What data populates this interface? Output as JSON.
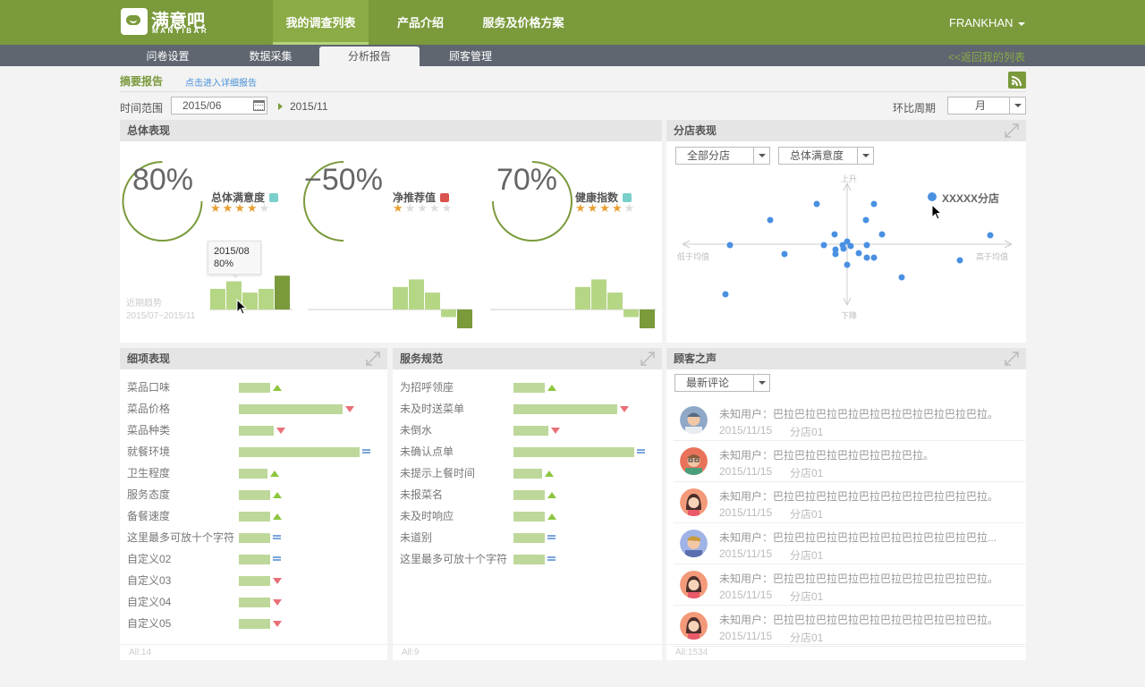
{
  "brand": {
    "name_cn": "满意吧",
    "name_en": "MANYIBAR"
  },
  "top_nav": [
    "我的调查列表",
    "产品介绍",
    "服务及价格方案"
  ],
  "user": {
    "name": "FRANKHAN"
  },
  "sub_nav": [
    "问卷设置",
    "数据采集",
    "分析报告",
    "顾客管理"
  ],
  "back_link": "<<返回我的列表",
  "page_title": "摘要报告",
  "detail_link": "点击进入详细报告",
  "filters": {
    "range_label": "时间范围",
    "start": "2015/06",
    "end": "2015/11",
    "cycle_label": "环比周期",
    "cycle_value": "月"
  },
  "overall": {
    "title": "总体表现",
    "metrics": [
      {
        "value": "80%",
        "name": "总体满意度",
        "color": "#79cfcb",
        "stars": 4,
        "trend": [
          0.55,
          0.75,
          0.45,
          0.55,
          0.9
        ]
      },
      {
        "value": "−50%",
        "name": "净推荐值",
        "color": "#d9534f",
        "stars": 1,
        "trend": [
          0.6,
          0.8,
          0.45,
          -0.2,
          -0.5
        ]
      },
      {
        "value": "70%",
        "name": "健康指数",
        "color": "#79cfcb",
        "stars": 4,
        "trend": [
          0.6,
          0.8,
          0.45,
          -0.2,
          -0.5
        ]
      }
    ],
    "trend_label": "近期趋势",
    "trend_range": "2015/07~2015/11",
    "tooltip": {
      "date": "2015/08",
      "value": "80%"
    }
  },
  "branch": {
    "title": "分店表现",
    "select_branch": "全部分店",
    "select_metric": "总体满意度",
    "axis_up": "上升",
    "axis_down": "下降",
    "axis_left": "低于均值",
    "axis_right": "高于均值",
    "highlight_label": "XXXXX分店",
    "color": "#4a90e2"
  },
  "details": {
    "title": "细项表现",
    "rows": [
      {
        "label": "菜品口味",
        "value": 0.26,
        "trend": "up"
      },
      {
        "label": "菜品价格",
        "value": 0.86,
        "trend": "down"
      },
      {
        "label": "菜品种类",
        "value": 0.29,
        "trend": "down"
      },
      {
        "label": "就餐环境",
        "value": 1.0,
        "trend": "eq"
      },
      {
        "label": "卫生程度",
        "value": 0.24,
        "trend": "up"
      },
      {
        "label": "服务态度",
        "value": 0.26,
        "trend": "up"
      },
      {
        "label": "备餐速度",
        "value": 0.26,
        "trend": "up"
      },
      {
        "label": "这里最多可放十个字符",
        "value": 0.26,
        "trend": "eq"
      },
      {
        "label": "自定义02",
        "value": 0.26,
        "trend": "eq"
      },
      {
        "label": "自定义03",
        "value": 0.26,
        "trend": "down"
      },
      {
        "label": "自定义04",
        "value": 0.26,
        "trend": "down"
      },
      {
        "label": "自定义05",
        "value": 0.26,
        "trend": "down"
      }
    ],
    "footer": "All:14"
  },
  "service": {
    "title": "服务规范",
    "rows": [
      {
        "label": "为招呼领座",
        "value": 0.26,
        "trend": "up"
      },
      {
        "label": "未及时送菜单",
        "value": 0.86,
        "trend": "down"
      },
      {
        "label": "未倒水",
        "value": 0.29,
        "trend": "down"
      },
      {
        "label": "未确认点单",
        "value": 1.0,
        "trend": "eq"
      },
      {
        "label": "未提示上餐时间",
        "value": 0.24,
        "trend": "up"
      },
      {
        "label": "未报菜名",
        "value": 0.26,
        "trend": "up"
      },
      {
        "label": "未及时响应",
        "value": 0.26,
        "trend": "up"
      },
      {
        "label": "未道别",
        "value": 0.26,
        "trend": "eq"
      },
      {
        "label": "这里最多可放十个字符",
        "value": 0.26,
        "trend": "eq"
      }
    ],
    "footer": "All:9"
  },
  "voices": {
    "title": "顾客之声",
    "select": "最新评论",
    "items": [
      {
        "text": "未知用户：巴拉巴拉巴拉巴拉巴拉巴拉巴拉巴拉巴拉巴拉。",
        "date": "2015/11/15",
        "shop": "分店01",
        "avatar": "man-cap"
      },
      {
        "text": "未知用户：巴拉巴拉巴拉巴拉巴拉巴拉巴拉。",
        "date": "2015/11/15",
        "shop": "分店01",
        "avatar": "man-glasses"
      },
      {
        "text": "未知用户：巴拉巴拉巴拉巴拉巴拉巴拉巴拉巴拉巴拉巴拉。",
        "date": "2015/11/15",
        "shop": "分店01",
        "avatar": "woman"
      },
      {
        "text": "未知用户：巴拉巴拉巴拉巴拉巴拉巴拉巴拉巴拉巴拉巴拉...",
        "date": "2015/11/15",
        "shop": "分店01",
        "avatar": "man-blue"
      },
      {
        "text": "未知用户：巴拉巴拉巴拉巴拉巴拉巴拉巴拉巴拉巴拉巴拉。",
        "date": "2015/11/15",
        "shop": "分店01",
        "avatar": "woman"
      },
      {
        "text": "未知用户：巴拉巴拉巴拉巴拉巴拉巴拉巴拉巴拉巴拉巴拉。",
        "date": "2015/11/15",
        "shop": "分店01",
        "avatar": "woman"
      }
    ],
    "footer": "All:1534"
  }
}
